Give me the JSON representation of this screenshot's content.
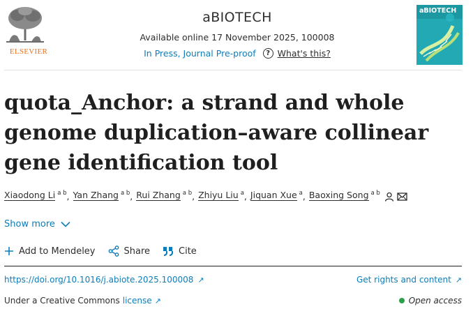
{
  "publisher": {
    "name": "ELSEVIER",
    "logo_icon": "tree-icon"
  },
  "journal": {
    "title": "aBIOTECH",
    "available": "Available online 17 November 2025, 100008",
    "status": "In Press, Journal Pre-proof",
    "whats_this": "What's this?"
  },
  "cover": {
    "title": "aBIOTECH",
    "color": "#1fa9b4"
  },
  "article": {
    "title": "quota_Anchor: a strand and whole genome duplication–aware collinear gene identification tool"
  },
  "authors": [
    {
      "name": "Xiaodong Li",
      "aff": "a b"
    },
    {
      "name": "Yan Zhang",
      "aff": "a b"
    },
    {
      "name": "Rui Zhang",
      "aff": "a b"
    },
    {
      "name": "Zhiyu Liu",
      "aff": "a"
    },
    {
      "name": "Jiquan Xue",
      "aff": "a"
    },
    {
      "name": "Baoxing Song",
      "aff": "a b"
    }
  ],
  "show_more": "Show more",
  "actions": {
    "mendeley": "Add to Mendeley",
    "share": "Share",
    "cite": "Cite"
  },
  "links": {
    "doi": "https://doi.org/10.1016/j.abiote.2025.100008",
    "rights": "Get rights and content"
  },
  "license": {
    "prefix": "Under a Creative Commons",
    "link": "license"
  },
  "open_access": "Open access",
  "colors": {
    "link": "#0c7dbb",
    "publisher": "#e9711c",
    "open_access_dot": "#2e9f4b"
  }
}
